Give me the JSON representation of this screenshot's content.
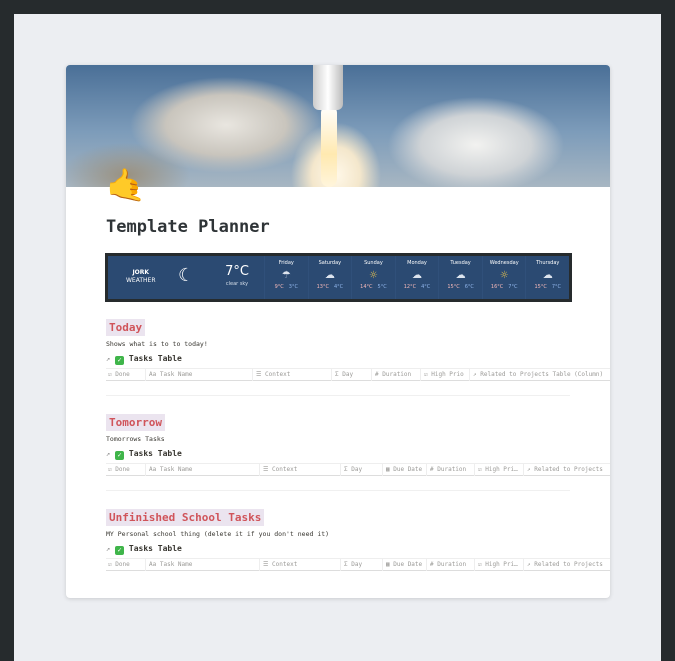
{
  "page": {
    "emoji": "🤙",
    "title": "Template Planner"
  },
  "weather": {
    "city": "JORK",
    "label": "WEATHER",
    "current_icon": "moon-icon",
    "temp": "7°C",
    "desc": "clear sky",
    "days": [
      {
        "name": "Friday",
        "icon": "rain-cloud",
        "high": "9°C",
        "low": "3°C"
      },
      {
        "name": "Saturday",
        "icon": "cloud",
        "high": "13°C",
        "low": "4°C"
      },
      {
        "name": "Sunday",
        "icon": "sun",
        "high": "14°C",
        "low": "5°C"
      },
      {
        "name": "Monday",
        "icon": "cloud",
        "high": "12°C",
        "low": "4°C"
      },
      {
        "name": "Tuesday",
        "icon": "cloud",
        "high": "15°C",
        "low": "6°C"
      },
      {
        "name": "Wednesday",
        "icon": "sun",
        "high": "16°C",
        "low": "7°C"
      },
      {
        "name": "Thursday",
        "icon": "cloud",
        "high": "15°C",
        "low": "7°C"
      }
    ]
  },
  "sections": [
    {
      "heading": "Today",
      "description": "Shows what is to to today!",
      "table_title": "Tasks Table",
      "columns": [
        "Done",
        "Task Name",
        "Context",
        "Day",
        "Duration",
        "High Prio",
        "Related to Projects Table (Column)"
      ]
    },
    {
      "heading": "Tomorrow",
      "description": "Tomorrows Tasks",
      "table_title": "Tasks Table",
      "columns": [
        "Done",
        "Task Name",
        "Context",
        "Day",
        "Due Date",
        "Duration",
        "High Pri…",
        "Related to Projects"
      ]
    },
    {
      "heading": "Unfinished School Tasks",
      "description": "MY Personal school thing (delete it if you don't need it)",
      "table_title": "Tasks Table",
      "columns": [
        "Done",
        "Task Name",
        "Context",
        "Day",
        "Due Date",
        "Duration",
        "High Pri…",
        "Related to Projects"
      ]
    }
  ]
}
